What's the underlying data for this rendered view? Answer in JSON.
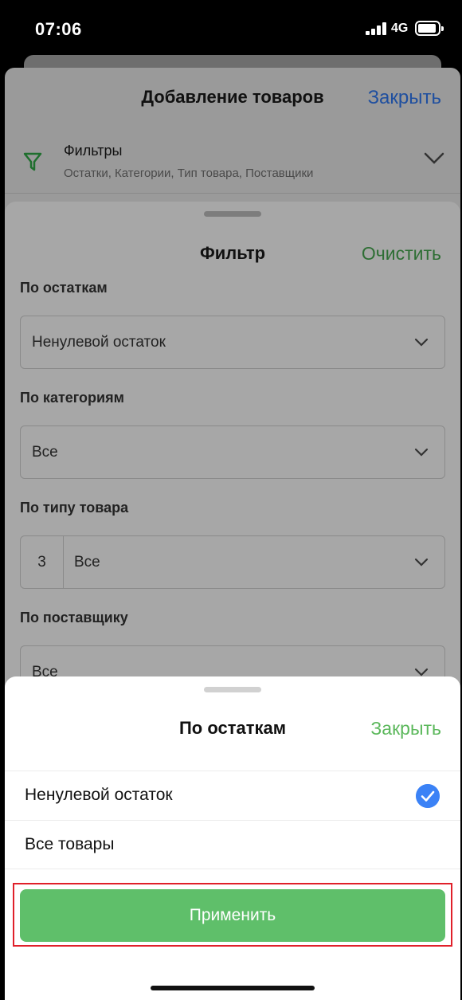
{
  "status_bar": {
    "time": "07:06",
    "network": "4G"
  },
  "add_products_sheet": {
    "title": "Добавление товаров",
    "close_label": "Закрыть",
    "filters": {
      "title": "Фильтры",
      "subtitle": "Остатки, Категории, Тип товара, Поставщики"
    }
  },
  "filter_sheet": {
    "title": "Фильтр",
    "clear_label": "Очистить",
    "sections": [
      {
        "label": "По остаткам",
        "value": "Ненулевой остаток"
      },
      {
        "label": "По категориям",
        "value": "Все"
      },
      {
        "label": "По типу товара",
        "count": "3",
        "value": "Все"
      },
      {
        "label": "По поставщику",
        "value": "Все"
      }
    ]
  },
  "stock_picker": {
    "title": "По остаткам",
    "close_label": "Закрыть",
    "options": [
      {
        "label": "Ненулевой остаток",
        "selected": true
      },
      {
        "label": "Все товары",
        "selected": false
      }
    ],
    "apply_label": "Применить"
  },
  "colors": {
    "accent_green": "#5fbf6a",
    "check_blue": "#3b82f6",
    "highlight_red": "#e0202a",
    "link_blue": "#1f4f9f"
  }
}
